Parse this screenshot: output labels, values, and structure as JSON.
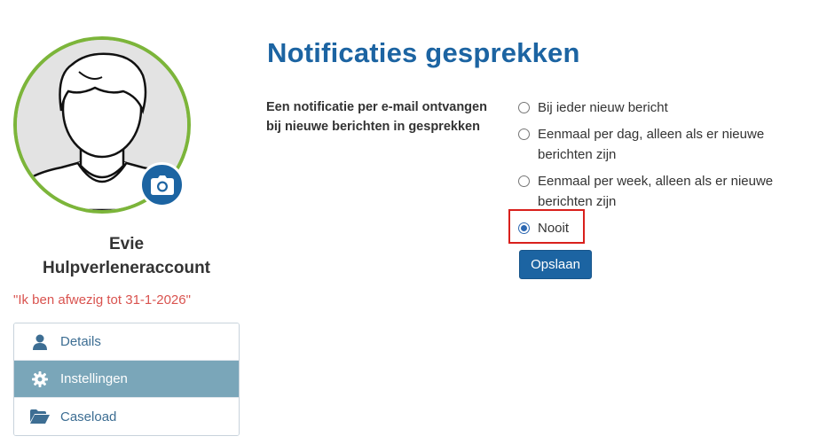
{
  "profile": {
    "first_name": "Evie",
    "last_name": "Hulpverleneraccount",
    "absence_note": "\"Ik ben afwezig tot 31-1-2026\"",
    "avatar_icon": "user-placeholder-icon",
    "camera_icon": "camera-icon",
    "ring_color": "#7cb53a",
    "camera_color": "#1c64a2"
  },
  "menu": {
    "items": [
      {
        "label": "Details",
        "icon": "user-icon",
        "active": false
      },
      {
        "label": "Instellingen",
        "icon": "gear-icon",
        "active": true
      },
      {
        "label": "Caseload",
        "icon": "folder-open-icon",
        "active": false
      }
    ]
  },
  "main": {
    "title": "Notificaties gesprekken",
    "setting_label": "Een notificatie per e-mail ontvangen bij nieuwe berichten in gesprekken",
    "options": [
      {
        "label": "Bij ieder nieuw bericht",
        "checked": false
      },
      {
        "label": "Eenmaal per dag, alleen als er nieuwe berichten zijn",
        "checked": false
      },
      {
        "label": "Eenmaal per week, alleen als er nieuwe berichten zijn",
        "checked": false
      },
      {
        "label": "Nooit",
        "checked": true
      }
    ],
    "save_label": "Opslaan",
    "accent_color": "#1c64a2",
    "highlight_color": "#d9201c"
  }
}
